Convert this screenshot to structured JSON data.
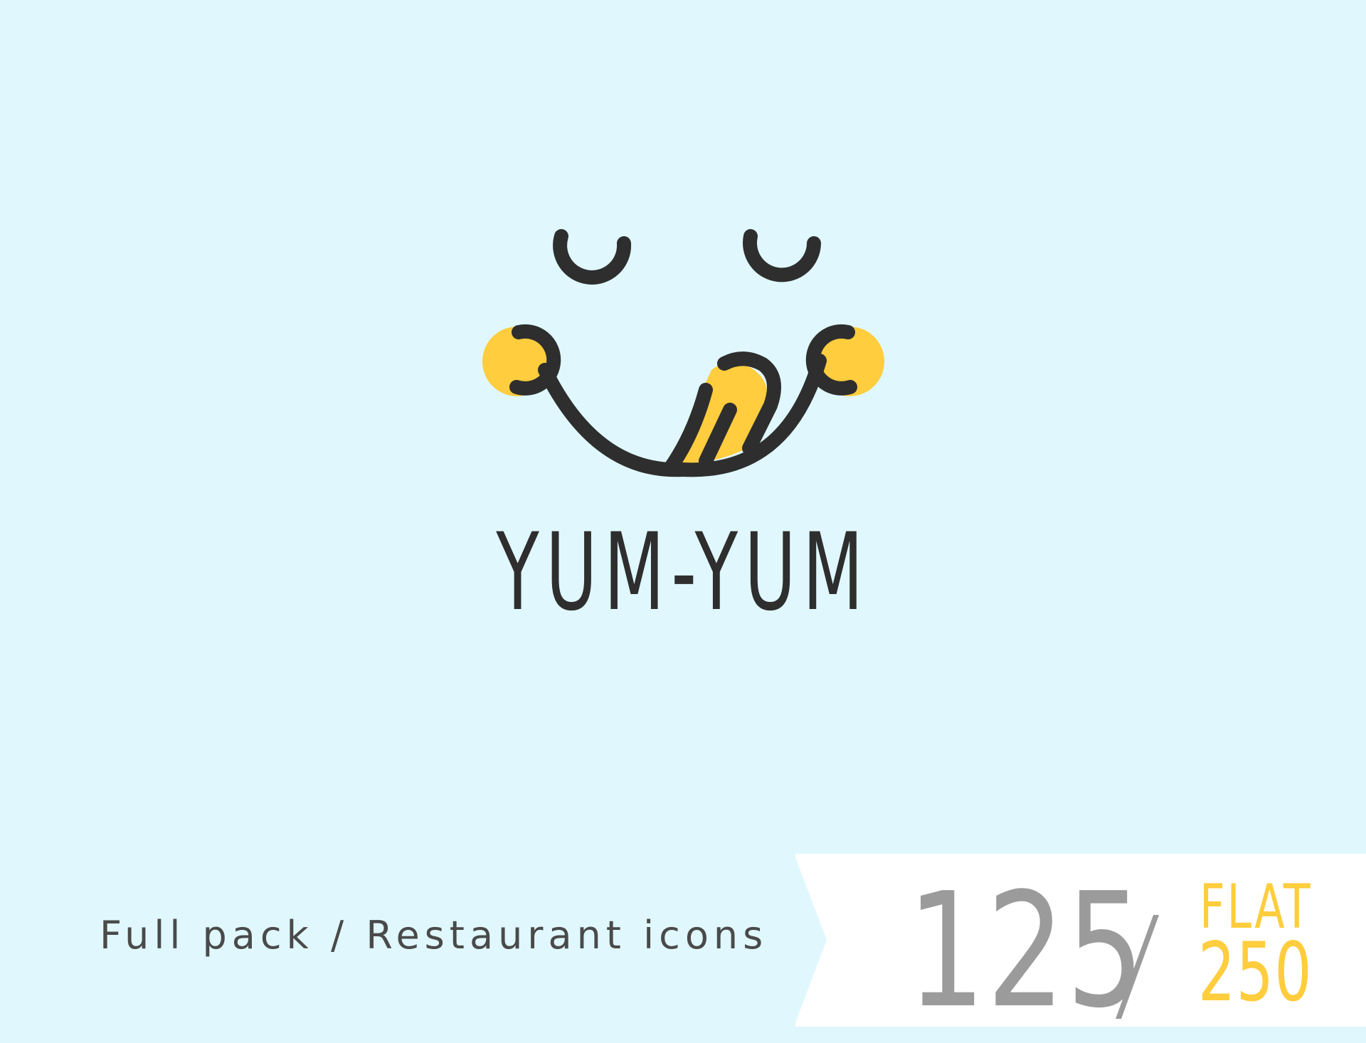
{
  "brand": {
    "title": "YUM-YUM"
  },
  "footer": {
    "tagline": "Full pack / Restaurant icons",
    "outline_count": "125",
    "separator": "/",
    "flat_label": "FLAT",
    "flat_count": "250"
  },
  "colors": {
    "background": "#E0F8FD",
    "panel": "#FFFFFF",
    "ink": "#2E2E2E",
    "accent_yellow": "#FFCD3D",
    "gray": "#9B9B9B",
    "tagline": "#4A4A4A"
  },
  "icons": {
    "logo": "smiling-face-licking-lips-icon"
  }
}
